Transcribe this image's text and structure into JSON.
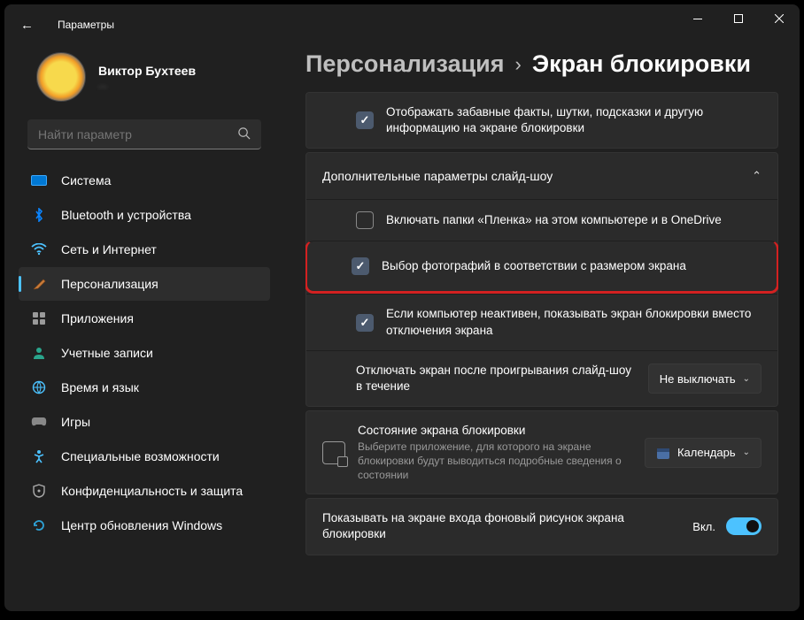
{
  "window": {
    "title": "Параметры"
  },
  "profile": {
    "name": "Виктор Бухтеев",
    "sub": "..."
  },
  "search": {
    "placeholder": "Найти параметр"
  },
  "nav": {
    "system": "Система",
    "bluetooth": "Bluetooth и устройства",
    "network": "Сеть и Интернет",
    "personalization": "Персонализация",
    "apps": "Приложения",
    "accounts": "Учетные записи",
    "time": "Время и язык",
    "gaming": "Игры",
    "accessibility": "Специальные возможности",
    "privacy": "Конфиденциальность и защита",
    "update": "Центр обновления Windows"
  },
  "breadcrumb": {
    "root": "Персонализация",
    "current": "Экран блокировки"
  },
  "opts": {
    "fun_facts": "Отображать забавные факты, шутки, подсказки и другую информацию на экране блокировки",
    "slideshow_header": "Дополнительные параметры слайд-шоу",
    "include_roll": "Включать папки «Пленка» на этом компьютере и в OneDrive",
    "fit_screen": "Выбор фотографий в соответствии с размером экрана",
    "when_inactive": "Если компьютер неактивен, показывать экран блокировки вместо отключения экрана",
    "turn_off_after": "Отключать экран после проигрывания слайд-шоу в течение",
    "turn_off_value": "Не выключать",
    "status_title": "Состояние экрана блокировки",
    "status_sub": "Выберите приложение, для которого на экране блокировки будут выводиться подробные сведения о состоянии",
    "status_value": "Календарь",
    "signin_bg": "Показывать на экране входа фоновый рисунок экрана блокировки",
    "on": "Вкл."
  }
}
